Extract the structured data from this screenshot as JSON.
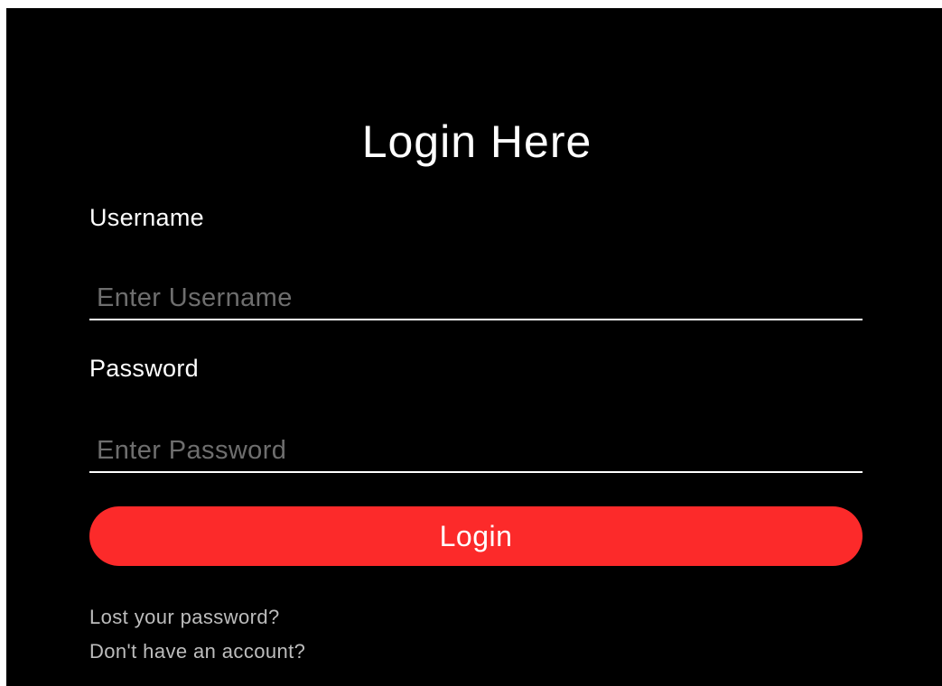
{
  "form": {
    "title": "Login Here",
    "username": {
      "label": "Username",
      "placeholder": "Enter Username",
      "value": ""
    },
    "password": {
      "label": "Password",
      "placeholder": "Enter Password",
      "value": ""
    },
    "login_label": "Login",
    "links": {
      "lost_password": "Lost your password?",
      "no_account": "Don't have an account?"
    }
  },
  "colors": {
    "background": "#000000",
    "accent": "#fc2a2a",
    "text": "#ffffff",
    "link": "#bdbdbd",
    "placeholder": "#6e6e6e"
  }
}
